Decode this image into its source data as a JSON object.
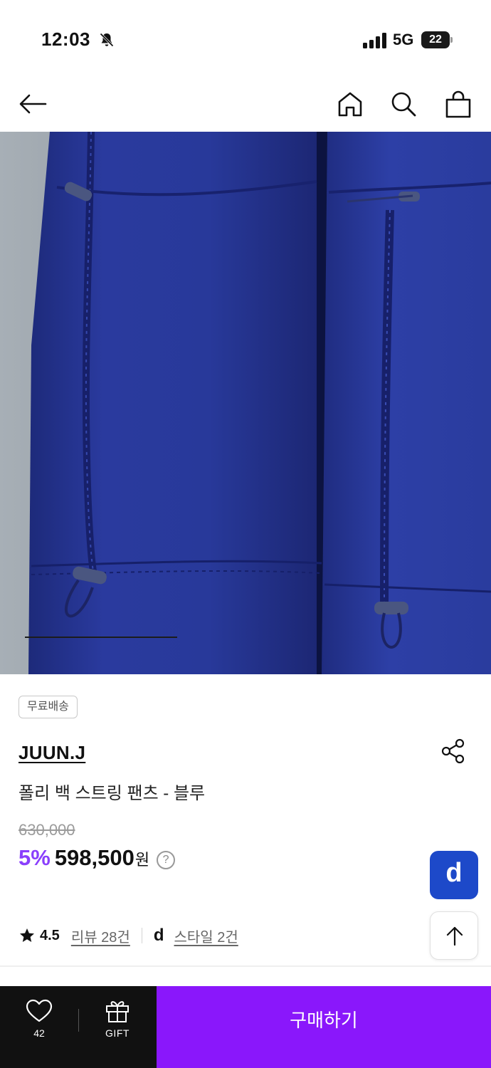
{
  "status_bar": {
    "time": "12:03",
    "network": "5G",
    "battery": "22",
    "icons": [
      "bell-off-icon",
      "signal-icon",
      "battery-icon"
    ]
  },
  "nav": {
    "icons": [
      "arrow-left-icon",
      "home-icon",
      "search-icon",
      "shopping-bag-icon"
    ]
  },
  "hero": {
    "image": "blue nylon pants with drawstring hems",
    "slide_progress": 0.31
  },
  "product": {
    "badge": "무료배송",
    "brand": "JUUN.J",
    "name": "폴리 백 스트링 팬츠 - 블루",
    "original_price": "630,000",
    "discount": "5%",
    "sale_price": "598,500",
    "currency": "원",
    "help": "?"
  },
  "rating": {
    "score": "4.5",
    "reviews": "리뷰 28건",
    "styles": "스타일 2건",
    "d_logo": "d"
  },
  "floating": {
    "d_button": "d",
    "top_button_icon": "arrow-up-icon"
  },
  "bottom_bar": {
    "like_count": "42",
    "gift_label": "GIFT",
    "buy_label": "구매하기"
  },
  "colors": {
    "accent": "#8a17fb",
    "discount": "#8a3ffc",
    "d_button": "#1d49c9",
    "bottom_dark": "#111111"
  }
}
